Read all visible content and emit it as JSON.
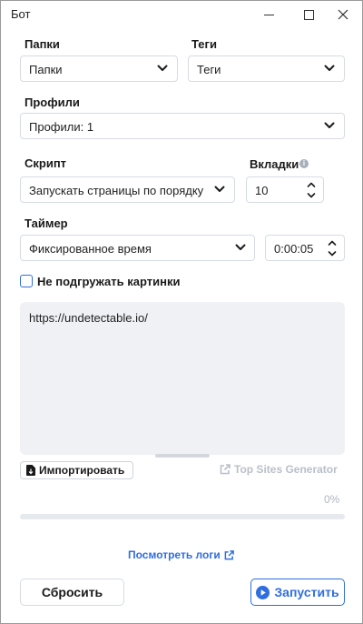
{
  "window": {
    "title": "Бот"
  },
  "folders": {
    "label": "Папки",
    "value": "Папки"
  },
  "tags": {
    "label": "Теги",
    "value": "Теги"
  },
  "profiles": {
    "label": "Профили",
    "value": "Профили: 1"
  },
  "script": {
    "label": "Скрипт",
    "value": "Запускать страницы по порядку"
  },
  "tabs": {
    "label": "Вкладки",
    "value": "10",
    "info_icon": "info-icon"
  },
  "timer": {
    "label": "Таймер",
    "mode": "Фиксированное время",
    "time": "0:00:05"
  },
  "images": {
    "label": "Не подгружать картинки",
    "checked": false
  },
  "urls": {
    "text": "https://undetectable.io/"
  },
  "actions": {
    "import_label": "Импортировать",
    "import_icon": "file-import-icon",
    "top_sites_label": "Top Sites Generator",
    "top_sites_icon": "external-link-icon"
  },
  "progress": {
    "text": "0%",
    "value": 0
  },
  "footer": {
    "logs_label": "Посмотреть логи",
    "logs_icon": "external-link-icon",
    "reset_label": "Сбросить",
    "run_label": "Запустить",
    "run_icon": "play-circle-icon"
  },
  "colors": {
    "accent": "#2f6ee0",
    "muted": "#b9c0ca",
    "textarea_bg": "#eff1f5",
    "border": "#d6dbe3"
  }
}
